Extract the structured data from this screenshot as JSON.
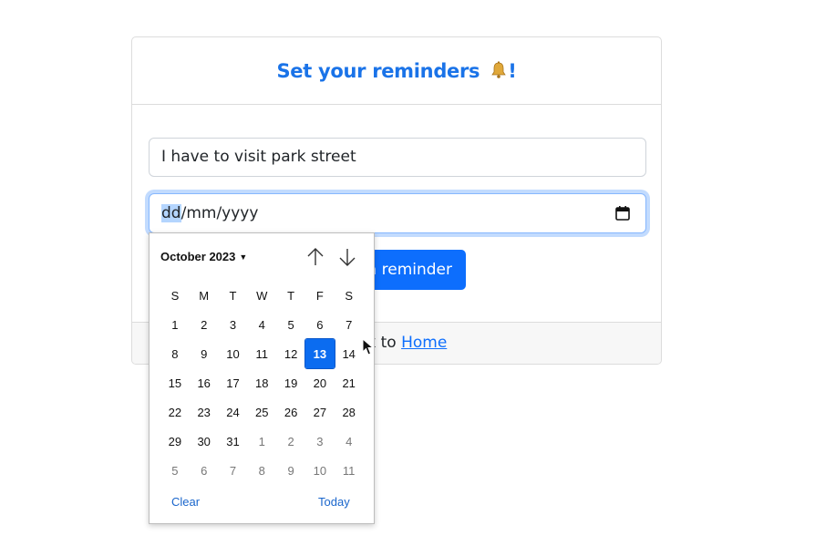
{
  "card": {
    "title": "Set your reminders",
    "title_icon": "bell-icon",
    "title_suffix": "!",
    "reminder_value": "I have to visit park street",
    "date_placeholder": {
      "day": "dd",
      "rest": "/mm/yyyy"
    },
    "submit_label": "a reminder",
    "footer_prefix": "ck to ",
    "footer_link": "Home"
  },
  "datepicker": {
    "month_label": "October 2023",
    "weekdays": [
      "S",
      "M",
      "T",
      "W",
      "T",
      "F",
      "S"
    ],
    "weeks": [
      [
        "1",
        "2",
        "3",
        "4",
        "5",
        "6",
        "7"
      ],
      [
        "8",
        "9",
        "10",
        "11",
        "12",
        "13",
        "14"
      ],
      [
        "15",
        "16",
        "17",
        "18",
        "19",
        "20",
        "21"
      ],
      [
        "22",
        "23",
        "24",
        "25",
        "26",
        "27",
        "28"
      ],
      [
        "29",
        "30",
        "31",
        "1",
        "2",
        "3",
        "4"
      ],
      [
        "5",
        "6",
        "7",
        "8",
        "9",
        "10",
        "11"
      ]
    ],
    "selected_day": "13",
    "clear_label": "Clear",
    "today_label": "Today"
  },
  "colors": {
    "accent": "#0d6efd",
    "title": "#1a73e8"
  }
}
